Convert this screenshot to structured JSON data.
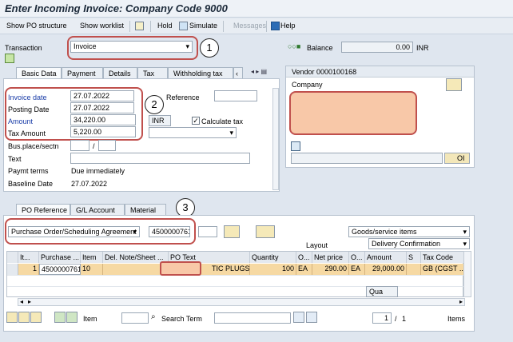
{
  "window": {
    "title": "Enter Incoming Invoice: Company Code 9000"
  },
  "toolbar": {
    "show_po_structure": "Show PO structure",
    "show_worklist": "Show worklist",
    "hold": "Hold",
    "simulate": "Simulate",
    "messages": "Messages",
    "help": "Help"
  },
  "header": {
    "transaction_label": "Transaction",
    "transaction_value": "Invoice",
    "balance_label": "Balance",
    "balance_value": "0.00",
    "balance_currency": "INR"
  },
  "tabs_top": [
    "Basic Data",
    "Payment",
    "Details",
    "Tax",
    "Withholding tax"
  ],
  "basic_data": {
    "invoice_date_label": "Invoice date",
    "invoice_date": "27.07.2022",
    "posting_date_label": "Posting Date",
    "posting_date": "27.07.2022",
    "amount_label": "Amount",
    "amount": "34,220.00",
    "currency": "INR",
    "calc_tax_label": "Calculate tax",
    "tax_amount_label": "Tax Amount",
    "tax_amount": "5,220.00",
    "reference_label": "Reference",
    "busplace_label": "Bus.place/sectn",
    "busplace_sep": "/",
    "text_label": "Text",
    "paymt_terms_label": "Paymt terms",
    "paymt_terms_value": "Due immediately",
    "baseline_label": "Baseline Date",
    "baseline_value": "27.07.2022"
  },
  "vendor": {
    "title": "Vendor 0000100168",
    "company_label": "Company",
    "oi_label": "OI"
  },
  "tabs_bottom": [
    "PO Reference",
    "G/L Account",
    "Material"
  ],
  "po_ref": {
    "type_value": "Purchase Order/Scheduling Agreement",
    "po_number": "4500000761",
    "goods_value": "Goods/service items",
    "layout_label": "Layout",
    "layout_value": "Delivery Confirmation"
  },
  "grid": {
    "columns": [
      "It...",
      "Purchase ...",
      "Item",
      "Del. Note/Sheet ...",
      "PO Text",
      "Quantity",
      "O...",
      "Net price",
      "O...",
      "Amount",
      "S",
      "Tax Code"
    ],
    "row": {
      "it": "1",
      "purchase": "4500000761",
      "item": "10",
      "del_note": "",
      "po_text": "TIC PLUGS",
      "quantity": "100",
      "o1": "EA",
      "net_price": "290.00",
      "o2": "EA",
      "amount": "29,000.00",
      "s": "",
      "tax_code": "GB (CGST ..."
    },
    "qua_label": "Qua"
  },
  "footer": {
    "item_label": "Item",
    "search_label": "Search Term",
    "page": "1",
    "page_sep": "/",
    "page_total": "1",
    "items_label": "Items"
  },
  "annotations": [
    "1",
    "2",
    "3"
  ],
  "colors": {
    "highlight_row": "#f6d9a3",
    "redact": "#f8c8a8",
    "annotation_red": "#c0504d"
  }
}
